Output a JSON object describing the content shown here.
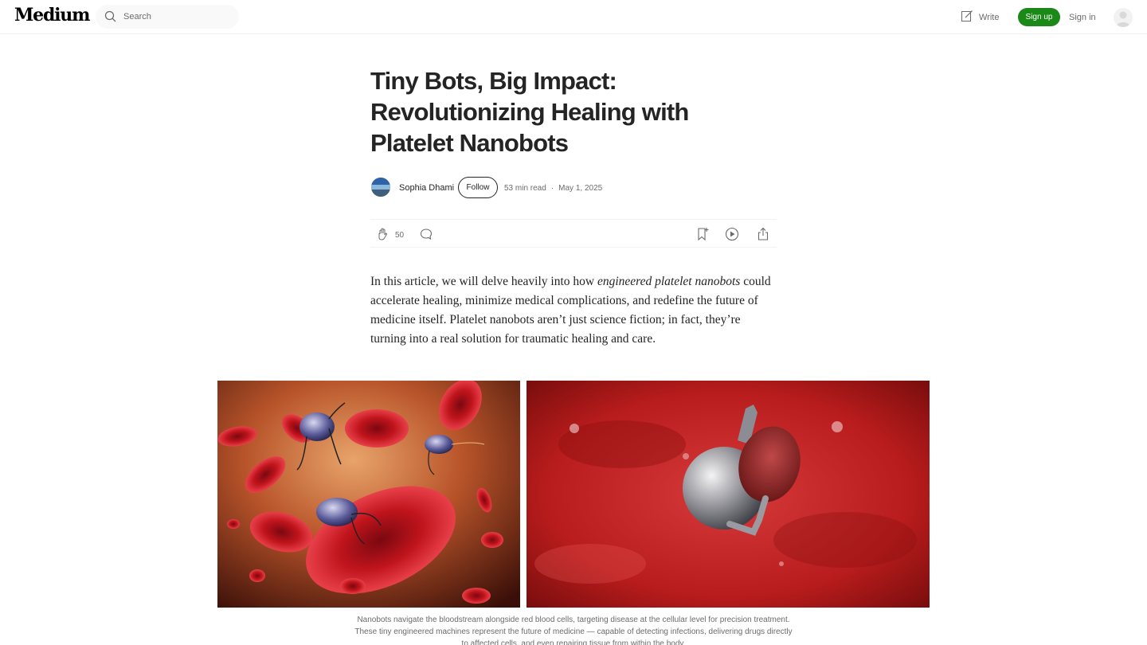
{
  "nav": {
    "logo": "Medium",
    "search_placeholder": "Search",
    "write_label": "Write",
    "signup_label": "Sign up",
    "signin_label": "Sign in"
  },
  "article": {
    "title": "Tiny Bots, Big Impact: Revolutionizing Healing with Platelet Nanobots",
    "author": "Sophia Dhami",
    "follow_label": "Follow",
    "read_time": "53 min read",
    "date": "May 1, 2025",
    "claps": "50",
    "intro_part1": "In this article, we will delve heavily into how ",
    "intro_em": "engineered platelet nanobots",
    "intro_part2": " could accelerate healing, minimize medical complications, and redefine the future of medicine itself. Platelet nanobots aren’t just science fiction; in fact, they’re turning into a real solution for traumatic healing and care.",
    "caption": "Nanobots navigate the bloodstream alongside red blood cells, targeting disease at the cellular level for precision treatment. These tiny engineered machines represent the future of medicine — capable of detecting infections, delivering drugs directly to affected cells, and even repairing tissue from within the body."
  },
  "colors": {
    "brand_green": "#1a8917",
    "text": "#242424",
    "muted": "#6b6b6b"
  }
}
